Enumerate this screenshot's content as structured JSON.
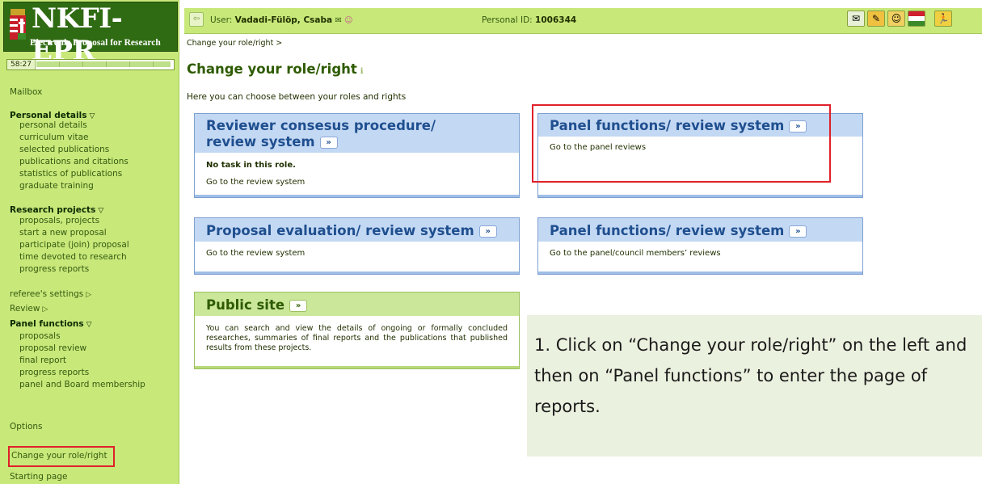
{
  "app": {
    "logo_title": "NKFI-EPR",
    "logo_subtitle": "Electronic Proposal for Research"
  },
  "timer": {
    "value": "58:27"
  },
  "sidebar": {
    "mailbox": "Mailbox",
    "personal_details": {
      "heading": "Personal details",
      "items": [
        "personal details",
        "curriculum vitae",
        "selected publications",
        "publications and citations",
        "statistics of publications",
        "graduate training"
      ]
    },
    "research_projects": {
      "heading": "Research projects",
      "items": [
        "proposals, projects",
        "start a new proposal",
        "participate (join) proposal",
        "time devoted to research",
        "progress reports"
      ]
    },
    "referees_settings": "referee's settings",
    "review": "Review",
    "panel_functions": {
      "heading": "Panel functions",
      "items": [
        "proposals",
        "proposal review",
        "final report",
        "progress reports",
        "panel and Board membership"
      ]
    },
    "options": "Options",
    "change_role": "Change your role/right",
    "starting_page": "Starting page"
  },
  "topbar": {
    "user_label": "User:",
    "user_name": "Vadadi-Fülöp, Csaba",
    "pid_label": "Personal ID:",
    "pid_value": "1006344"
  },
  "main": {
    "breadcrumb": "Change your role/right >",
    "title": "Change your role/right",
    "intro": "Here you can choose between your roles and rights",
    "cards": {
      "reviewer_consensus": {
        "title_line1": "Reviewer consesus procedure/",
        "title_line2": "review system",
        "note": "No task in this role.",
        "link": "Go to the review system"
      },
      "panel_functions_1": {
        "title": "Panel functions/ review system",
        "link": "Go to the panel reviews"
      },
      "proposal_evaluation": {
        "title": "Proposal evaluation/ review system",
        "link": "Go to the review system"
      },
      "panel_functions_2": {
        "title": "Panel functions/ review system",
        "link": "Go to the panel/council members’ reviews"
      },
      "public_site": {
        "title": "Public site",
        "text": "You can search and view the details of ongoing or formally concluded researches, summaries of final reports and the publications that published results from these projects."
      }
    },
    "goto_glyph": "»"
  },
  "instruction": {
    "text": "1. Click on “Change your role/right” on the left and then on “Panel functions” to enter the page of reports."
  },
  "colors": {
    "sidebar_bg": "#c8e87a",
    "logo_bg": "#2f6b12",
    "card_header_blue": "#c3d8f3",
    "card_header_green": "#cbe79a",
    "highlight_red": "#e0202a"
  }
}
